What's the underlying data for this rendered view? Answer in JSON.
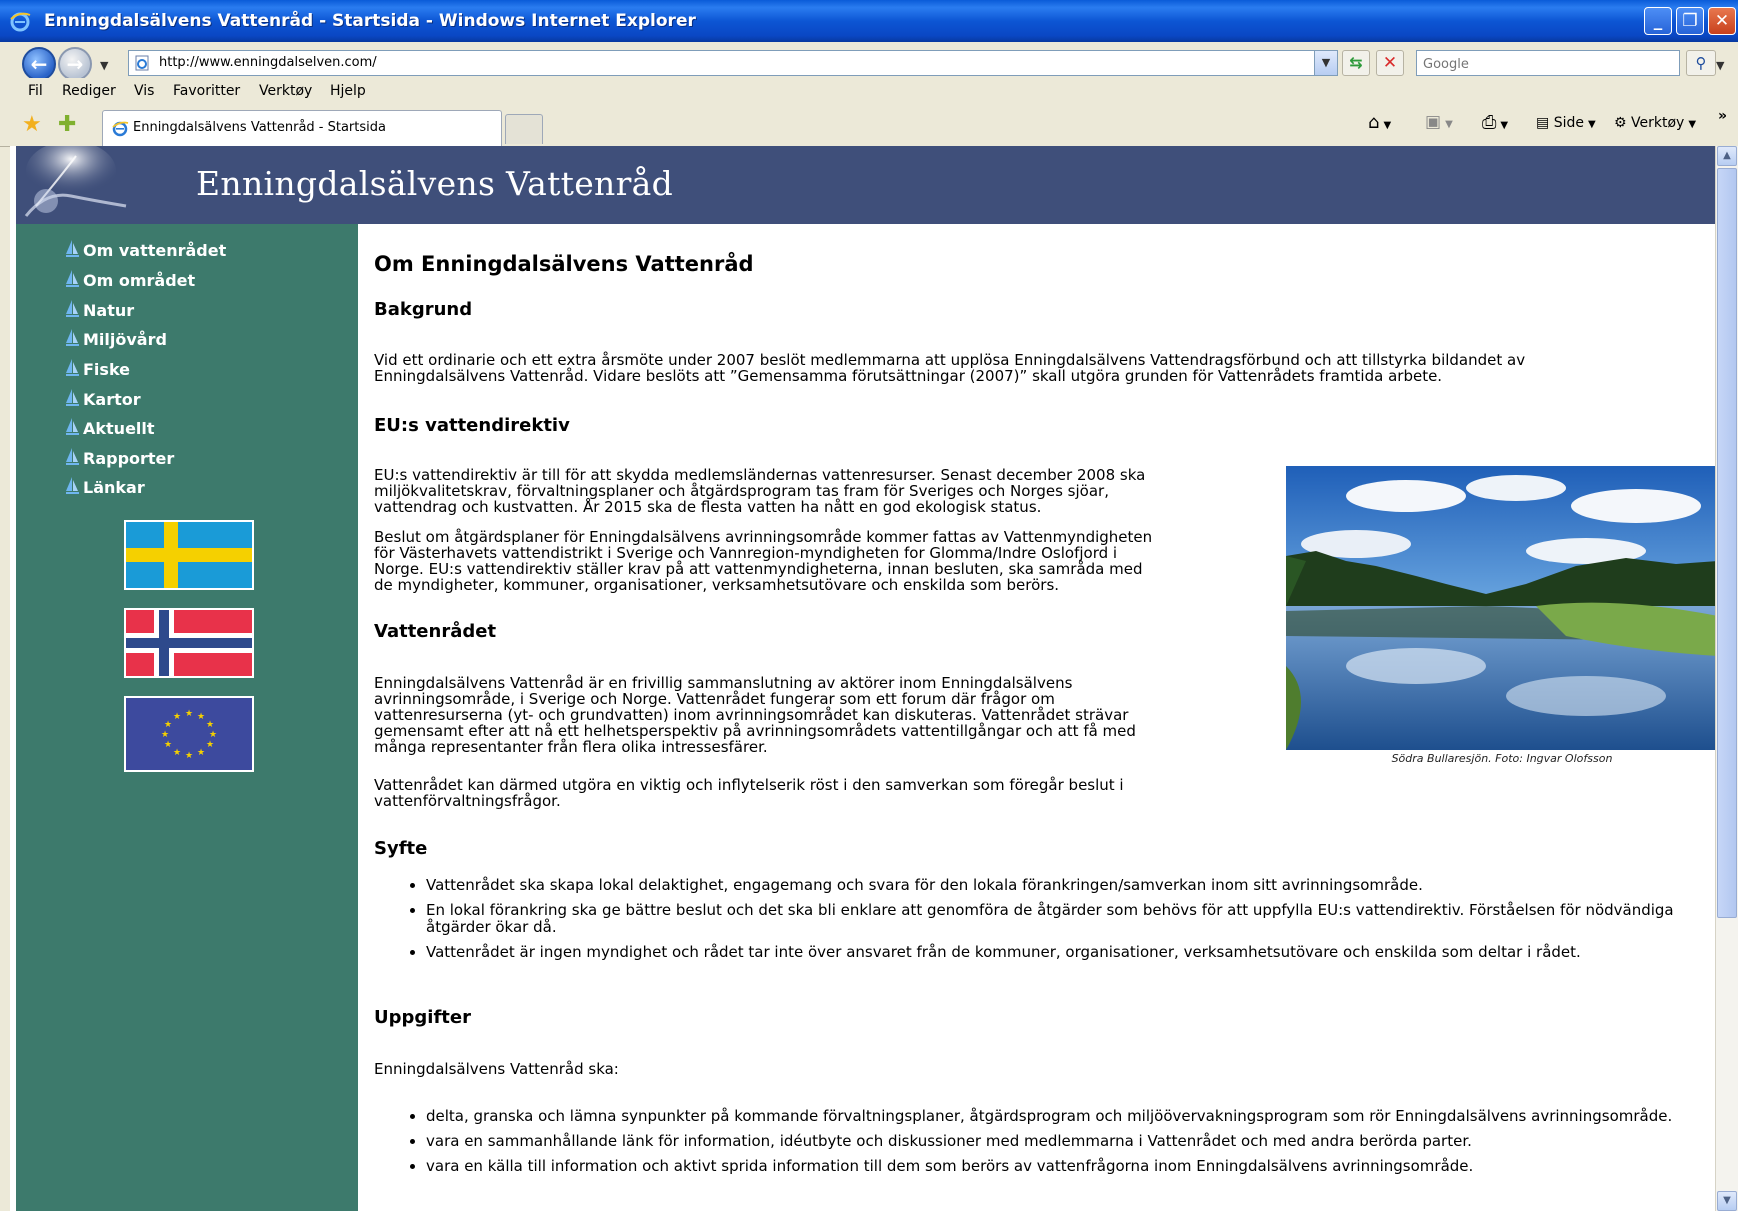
{
  "window": {
    "title": "Enningdalsälvens Vattenråd - Startsida - Windows Internet Explorer",
    "minimize": "_",
    "restore": "❐",
    "close": "✕"
  },
  "address": {
    "url": "http://www.enningdalselven.com/",
    "search_placeholder": "Google"
  },
  "menu": {
    "items": [
      "Fil",
      "Rediger",
      "Vis",
      "Favoritter",
      "Verktøy",
      "Hjelp"
    ]
  },
  "tabs": {
    "active_label": "Enningdalsälvens Vattenråd - Startsida"
  },
  "command_bar": {
    "side_label": "Side",
    "tools_label": "Verktøy",
    "chevron": "»"
  },
  "site": {
    "title": "Enningdalsälvens Vattenråd",
    "nav": [
      "Om vattenrådet",
      "Om området",
      "Natur",
      "Miljövård",
      "Fiske",
      "Kartor",
      "Aktuellt",
      "Rapporter",
      "Länkar"
    ],
    "nav_accent": "#6fb6f0"
  },
  "content": {
    "heading": "Om Enningdalsälvens Vattenråd",
    "bakgrund_heading": "Bakgrund",
    "bakgrund_line1": " Vid ett ordinarie och ett extra årsmöte under 2007 beslöt medlemmarna att upplösa Enningdalsälvens Vattendragsförbund och att tillstyrka bildandet av",
    "bakgrund_line2": "Enningdalsälvens Vattenråd. Vidare beslöts att ”Gemensamma förutsättningar (2007)” skall utgöra grunden för Vattenrådets framtida arbete.",
    "eu_heading": "EU:s vattendirektiv",
    "eu_p1": [
      " EU:s vattendirektiv är till för att skydda medlemsländernas vattenresurser. Senast december 2008 ska",
      "miljökvalitetskrav, förvaltningsplaner och åtgärdsprogram tas fram för Sveriges och Norges sjöar,",
      "vattendrag och kustvatten. År 2015 ska de flesta vatten ha nått en god ekologisk status."
    ],
    "eu_p2": [
      " Beslut om åtgärdsplaner för Enningdalsälvens avrinningsområde kommer fattas av Vattenmyndigheten",
      "för Västerhavets vattendistrikt i Sverige och Vannregion-myndigheten for Glomma/Indre Oslofjord i",
      "Norge. EU:s vattendirektiv ställer krav på att vattenmyndigheterna, innan besluten, ska samråda med",
      "de myndigheter, kommuner, organisationer, verksamhetsutövare och enskilda som berörs."
    ],
    "vattenradet_heading": "Vattenrådet",
    "vr_p1": [
      " Enningdalsälvens Vattenråd är en frivillig sammanslutning av aktörer inom Enningdalsälvens",
      "avrinningsområde, i Sverige och Norge. Vattenrådet fungerar som ett forum där frågor om",
      "vattenresurserna (yt- och grundvatten) inom avrinningsområdet kan diskuteras. Vattenrådet strävar",
      "gemensamt efter att nå ett helhetsperspektiv på avrinningsområdets vattentillgångar och att få med",
      "många representanter från flera olika intressesfärer."
    ],
    "vr_p2": [
      " Vattenrådet kan därmed utgöra en viktig och inflytelserik röst i den samverkan som föregår beslut i",
      "vattenförvaltningsfrågor."
    ],
    "photo_caption": "Södra Bullaresjön. Foto: Ingvar Olofsson",
    "syfte_heading": "Syfte",
    "syfte_items": [
      "Vattenrådet ska skapa lokal delaktighet, engagemang och svara för den lokala förankringen/samverkan inom sitt avrinningsområde.",
      "En lokal förankring ska ge bättre beslut och det ska bli enklare att genomföra de åtgärder som behövs för att uppfylla EU:s vattendirektiv. Förståelsen för nödvändiga åtgärder ökar då.",
      "Vattenrådet är ingen myndighet och rådet tar inte över ansvaret från de kommuner, organisationer, verksamhetsutövare och enskilda som deltar i rådet."
    ],
    "uppgifter_heading": "Uppgifter",
    "uppgifter_intro": " Enningdalsälvens Vattenråd ska:",
    "uppgifter_items": [
      "delta, granska och lämna synpunkter på kommande förvaltningsplaner, åtgärdsprogram och miljöövervakningsprogram som rör Enningdalsälvens avrinningsområde.",
      "vara en sammanhållande länk för information, idéutbyte och diskussioner med medlemmarna i Vattenrådet och med andra berörda parter.",
      "vara en källa till information och aktivt sprida information till dem som berörs av vattenfrågorna inom Enningdalsälvens avrinningsområde."
    ]
  },
  "colors": {
    "header_bg": "#3f4f7a",
    "sidebar_bg": "#3d7a6c",
    "titlebar": "#0a5bd8"
  }
}
